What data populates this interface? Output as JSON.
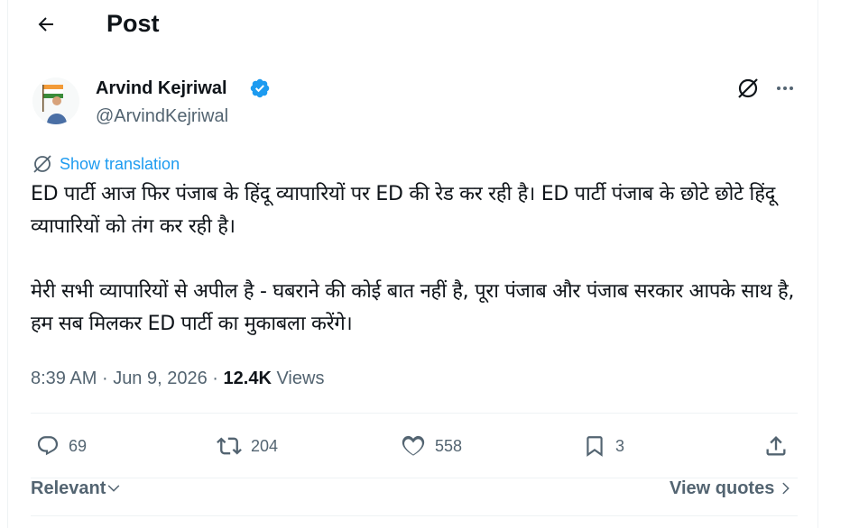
{
  "header": {
    "title": "Post"
  },
  "author": {
    "name": "Arvind Kejriwal",
    "handle": "@ArvindKejriwal",
    "verified": true
  },
  "translate": {
    "label": "Show translation"
  },
  "tweet": {
    "paragraphs": [
      "ED पार्टी आज फिर पंजाब के हिंदू व्यापारियों पर ED की रेड कर रही है। ED पार्टी पंजाब के छोटे छोटे हिंदू व्यापारियों को तंग कर रही है।",
      "मेरी सभी व्यापारियों से अपील है - घबराने की कोई बात नहीं है, पूरा पंजाब और पंजाब सरकार आपके साथ है, हम सब मिलकर ED पार्टी का मुकाबला करेंगे।"
    ]
  },
  "meta": {
    "time": "8:39 AM",
    "sep": "·",
    "date": "Jun 9, 2026",
    "views_count": "12.4K",
    "views_label": "Views"
  },
  "actions": {
    "replies": "69",
    "reposts": "204",
    "likes": "558",
    "bookmarks": "3"
  },
  "footer": {
    "sort_label": "Relevant",
    "quotes_label": "View quotes"
  },
  "colors": {
    "accent": "#1d9bf0",
    "muted": "#536471",
    "text": "#0f1419",
    "border": "#eff3f4"
  },
  "icons": [
    "back-arrow-icon",
    "verified-badge-icon",
    "grok-icon",
    "more-icon",
    "translate-icon",
    "reply-icon",
    "repost-icon",
    "like-icon",
    "bookmark-icon",
    "share-icon",
    "chevron-down-icon",
    "chevron-right-icon"
  ]
}
